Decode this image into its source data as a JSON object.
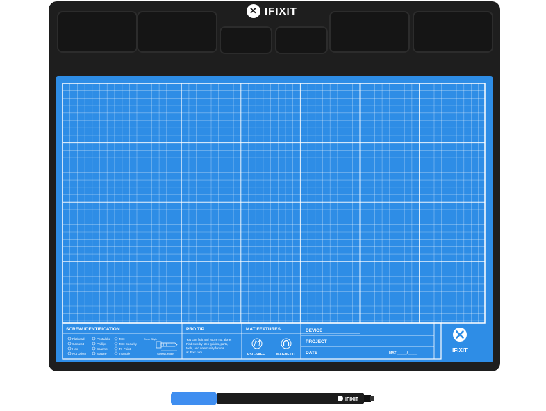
{
  "brand": {
    "name": "IFIXIT",
    "icon": "x-logo-icon"
  },
  "info_panel": {
    "screw_identification": {
      "title": "SCREW IDENTIFICATION",
      "types_col1": [
        "Flathead",
        "Gamebit",
        "Hex",
        "Nut Driver"
      ],
      "types_col2": [
        "Pentalobe",
        "Phillips",
        "Spanner",
        "Square"
      ],
      "types_col3": [
        "Torx",
        "Torx Security",
        "Tri-Point",
        "Triangle"
      ],
      "drive_style_label": "Drive Style",
      "screw_length_label": "Screw Length"
    },
    "pro_tip": {
      "title": "PRO TIP",
      "lines": [
        "You can fix it and you're not alone!",
        "Find step-by-step guides, parts,",
        "tools, and community forums",
        "at iFixit.com"
      ]
    },
    "mat_features": {
      "title": "MAT FEATURES",
      "items": [
        {
          "label": "ESD-SAFE",
          "icon": "esd-safe-icon"
        },
        {
          "label": "MAGNETIC",
          "icon": "magnet-icon"
        }
      ]
    },
    "fields": {
      "device": "DEVICE",
      "project": "PROJECT",
      "date": "DATE",
      "mat": "MAT _____/_____"
    },
    "logo_label": "IFIXIT"
  },
  "marker": {
    "brand": "IFIXIT"
  },
  "colors": {
    "mat_blue": "#2e8de6",
    "frame_black": "#1e1e1e",
    "grid_line": "#ffffff",
    "marker_cap": "#3f8ef0"
  }
}
